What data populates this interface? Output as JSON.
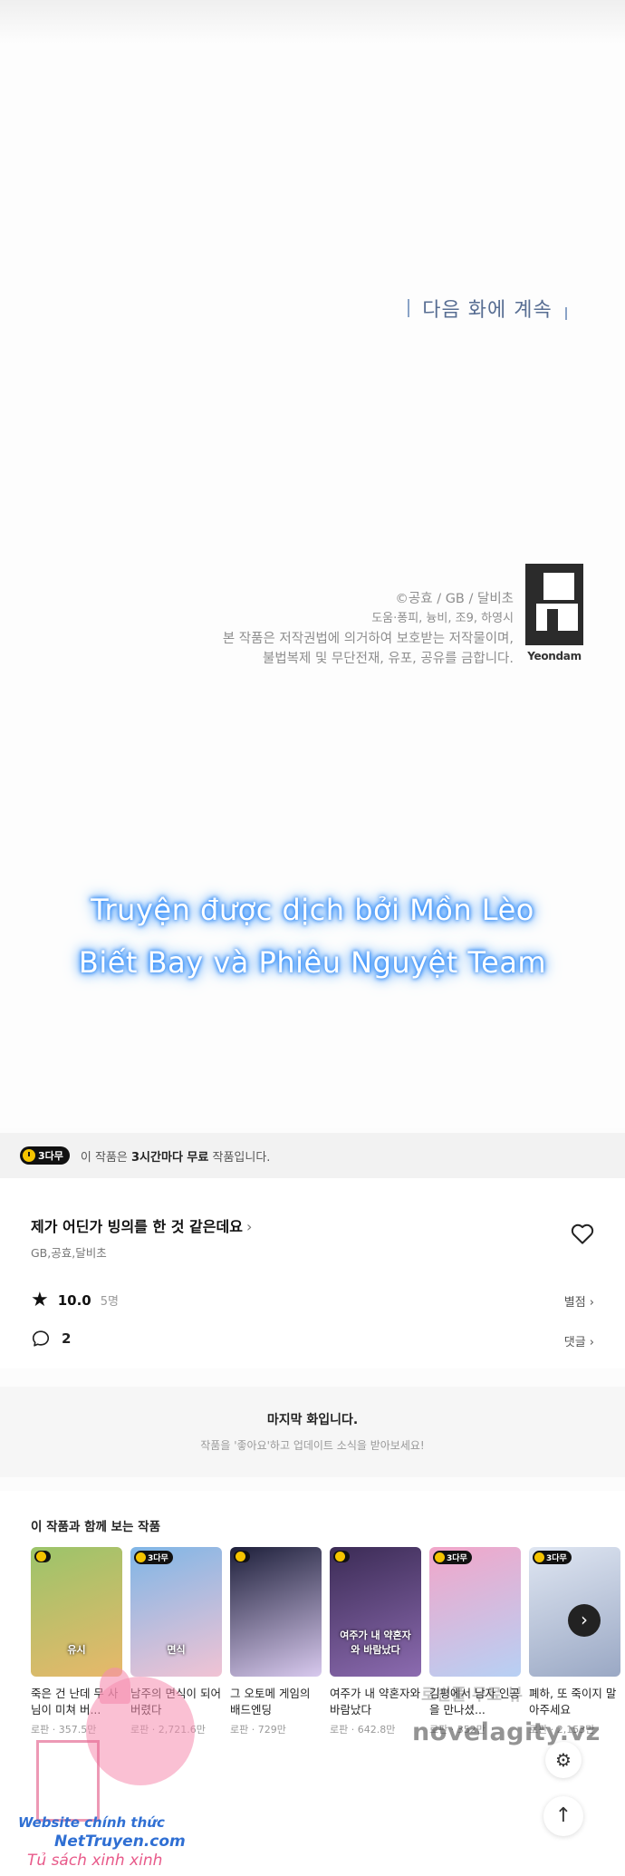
{
  "comic": {
    "next_episode": "다음 화에 계속",
    "copyright_line1": "©공효 / GB / 달비초",
    "copyright_line2": "도움·퐁피, 늉비, 조9, 하영시",
    "copyright_line3": "본 작품은 저작권법에 의거하여 보호받는 저작물이며,",
    "copyright_line4": "불법복제 및 무단전재, 유포, 공유를 금합니다.",
    "logo_label": "Yeondam",
    "translator_line1": "Truyện được dịch bởi Mồn Lèo",
    "translator_line2": "Biết Bay và Phiêu Nguyệt Team"
  },
  "notice": {
    "badge": "3다무",
    "text_prefix": "이 작품은 ",
    "text_bold": "3시간마다 무료",
    "text_suffix": " 작품입니다."
  },
  "work": {
    "title": "제가 어딘가 빙의를 한 것 같은데요",
    "chevron": "›",
    "authors": "GB,공효,달비초",
    "rating": "10.0",
    "rating_count": "5명",
    "rate_label": "별점 ›",
    "comments": "2",
    "comments_label": "댓글 ›"
  },
  "last_episode": {
    "heading": "마지막 화입니다.",
    "sub": "작품을 '좋아요'하고 업데이트 소식을 받아보세요!"
  },
  "recommendations": {
    "heading": "이 작품과 함께 보는 작품",
    "items": [
      {
        "badge": "",
        "name": "죽은 건 난데 무 사님이 미쳐 버...",
        "meta": "로판 · 357.5만",
        "cover_text": "유시",
        "c1": "#9bc46a",
        "c2": "#e8b86a"
      },
      {
        "badge": "3다무",
        "name": "남주의 면식이 되어 버렸다",
        "meta": "로판 · 2,721.6만",
        "cover_text": "면식",
        "c1": "#7fb6e6",
        "c2": "#f1c3d4"
      },
      {
        "badge": "",
        "name": "그 오토메 게임의 배드엔딩",
        "meta": "로판 · 729만",
        "cover_text": "",
        "c1": "#1d1f3a",
        "c2": "#d8c9ee"
      },
      {
        "badge": "",
        "name": "여주가 내 약혼자와 바람났다",
        "meta": "로판 · 642.8만",
        "cover_text": "여주가 내 약혼자와 바람났다",
        "c1": "#3b2b55",
        "c2": "#8c6bb0"
      },
      {
        "badge": "3다무",
        "name": "김평에서 남자 인공을 만나셨...",
        "meta": "로판 · 352만",
        "cover_text": "",
        "c1": "#f2a6c9",
        "c2": "#b7d0f4"
      },
      {
        "badge": "3다무",
        "name": "폐하, 또 죽이지 말아주세요",
        "meta": "로판 · 2,153만",
        "cover_text": "",
        "c1": "#dfe6f2",
        "c2": "#9aa8c4"
      }
    ]
  },
  "controls": {
    "next_arrow": "›",
    "settings": "⚙",
    "scroll_top": "↑"
  },
  "watermarks": {
    "right_small": "로빈플 무료 뷰",
    "right_main": "novelagity.vz",
    "left_line1": "Website chính thức",
    "left_line2": "NetTruyen.com",
    "left_line3": "Tủ sách xinh xinh"
  }
}
